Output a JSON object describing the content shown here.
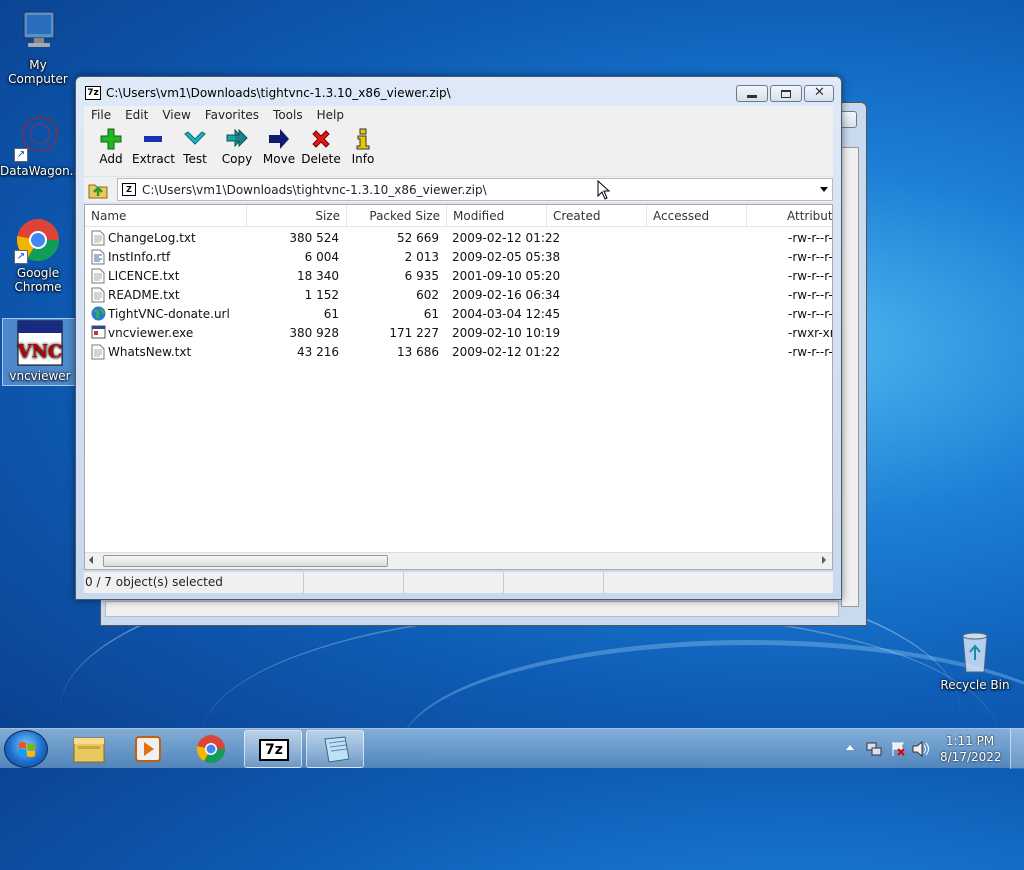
{
  "desktop": {
    "icons": [
      {
        "label": "My Computer"
      },
      {
        "label": "DataWagon..."
      },
      {
        "label": "Google Chrome"
      },
      {
        "label": "vncviewer"
      },
      {
        "label": "Recycle Bin"
      }
    ]
  },
  "window": {
    "title": "C:\\Users\\vm1\\Downloads\\tightvnc-1.3.10_x86_viewer.zip\\",
    "app_icon_text": "7z",
    "menu": [
      "File",
      "Edit",
      "View",
      "Favorites",
      "Tools",
      "Help"
    ],
    "toolbar": [
      {
        "label": "Add",
        "icon": "plus-icon",
        "color": "#22b822"
      },
      {
        "label": "Extract",
        "icon": "minus-icon",
        "color": "#1a2fb0"
      },
      {
        "label": "Test",
        "icon": "check-icon",
        "color": "#18b8c8"
      },
      {
        "label": "Copy",
        "icon": "double-arrow-icon",
        "color": "#1aa6a6"
      },
      {
        "label": "Move",
        "icon": "arrow-right-icon",
        "color": "#101a70"
      },
      {
        "label": "Delete",
        "icon": "x-icon",
        "color": "#e01818"
      },
      {
        "label": "Info",
        "icon": "info-icon",
        "color": "#e8c800"
      }
    ],
    "address": "C:\\Users\\vm1\\Downloads\\tightvnc-1.3.10_x86_viewer.zip\\",
    "columns": [
      "Name",
      "Size",
      "Packed Size",
      "Modified",
      "Created",
      "Accessed",
      "Attribute"
    ],
    "files": [
      {
        "name": "ChangeLog.txt",
        "size": "380 524",
        "packed": "52 669",
        "modified": "2009-02-12 01:22",
        "attr": "-rw-r--r-",
        "icon": "text-file-icon"
      },
      {
        "name": "InstInfo.rtf",
        "size": "6 004",
        "packed": "2 013",
        "modified": "2009-02-05 05:38",
        "attr": "-rw-r--r-",
        "icon": "rtf-file-icon"
      },
      {
        "name": "LICENCE.txt",
        "size": "18 340",
        "packed": "6 935",
        "modified": "2001-09-10 05:20",
        "attr": "-rw-r--r-",
        "icon": "text-file-icon"
      },
      {
        "name": "README.txt",
        "size": "1 152",
        "packed": "602",
        "modified": "2009-02-16 06:34",
        "attr": "-rw-r--r-",
        "icon": "text-file-icon"
      },
      {
        "name": "TightVNC-donate.url",
        "size": "61",
        "packed": "61",
        "modified": "2004-03-04 12:45",
        "attr": "-rw-r--r-",
        "icon": "globe-icon"
      },
      {
        "name": "vncviewer.exe",
        "size": "380 928",
        "packed": "171 227",
        "modified": "2009-02-10 10:19",
        "attr": "-rwxr-xr-",
        "icon": "exe-file-icon"
      },
      {
        "name": "WhatsNew.txt",
        "size": "43 216",
        "packed": "13 686",
        "modified": "2009-02-12 01:22",
        "attr": "-rw-r--r-",
        "icon": "text-file-icon"
      }
    ],
    "status": "0 / 7 object(s) selected"
  },
  "taskbar": {
    "clock_time": "1:11 PM",
    "clock_date": "8/17/2022",
    "active_item": "7z"
  }
}
